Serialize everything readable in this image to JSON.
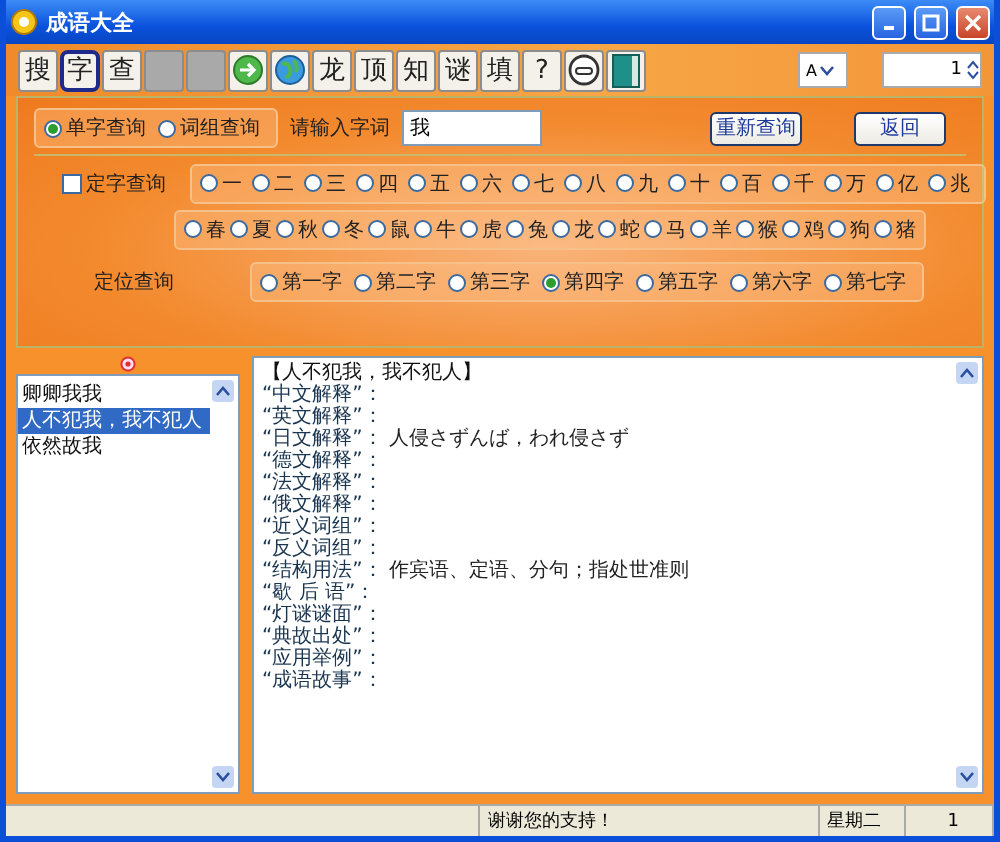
{
  "window": {
    "title": "成语大全"
  },
  "toolbar": {
    "buttons": [
      {
        "kind": "text",
        "label": "搜",
        "selected": false
      },
      {
        "kind": "text",
        "label": "字",
        "selected": true
      },
      {
        "kind": "text",
        "label": "查",
        "selected": false
      },
      {
        "kind": "blank",
        "selected": false
      },
      {
        "kind": "blank",
        "selected": false
      },
      {
        "kind": "arrow",
        "selected": false
      },
      {
        "kind": "globe",
        "selected": false
      },
      {
        "kind": "text",
        "label": "龙",
        "selected": false
      },
      {
        "kind": "text",
        "label": "顶",
        "selected": false
      },
      {
        "kind": "text",
        "label": "知",
        "selected": false
      },
      {
        "kind": "text",
        "label": "谜",
        "selected": false
      },
      {
        "kind": "text",
        "label": "填",
        "selected": false
      },
      {
        "kind": "text",
        "label": "?",
        "selected": false
      },
      {
        "kind": "smiley",
        "selected": false
      },
      {
        "kind": "book",
        "selected": false
      }
    ],
    "font_select": {
      "value": "A"
    },
    "page_spin": {
      "value": "1"
    }
  },
  "search": {
    "modes": [
      {
        "label": "单字查询",
        "selected": true
      },
      {
        "label": "词组查询",
        "selected": false
      }
    ],
    "input_label": "请输入字词",
    "input_value": "我",
    "buttons": [
      "重新查询",
      "返回"
    ]
  },
  "fixed_char": {
    "label": "定字查询",
    "checked": false,
    "numbers": [
      {
        "label": "一",
        "selected": false
      },
      {
        "label": "二",
        "selected": false
      },
      {
        "label": "三",
        "selected": false
      },
      {
        "label": "四",
        "selected": false
      },
      {
        "label": "五",
        "selected": false
      },
      {
        "label": "六",
        "selected": false
      },
      {
        "label": "七",
        "selected": false
      },
      {
        "label": "八",
        "selected": false
      },
      {
        "label": "九",
        "selected": false
      },
      {
        "label": "十",
        "selected": false
      },
      {
        "label": "百",
        "selected": false
      },
      {
        "label": "千",
        "selected": false
      },
      {
        "label": "万",
        "selected": false
      },
      {
        "label": "亿",
        "selected": false
      },
      {
        "label": "兆",
        "selected": false
      }
    ],
    "zodiac": [
      {
        "label": "春",
        "selected": false
      },
      {
        "label": "夏",
        "selected": false
      },
      {
        "label": "秋",
        "selected": false
      },
      {
        "label": "冬",
        "selected": false
      },
      {
        "label": "鼠",
        "selected": false
      },
      {
        "label": "牛",
        "selected": false
      },
      {
        "label": "虎",
        "selected": false
      },
      {
        "label": "兔",
        "selected": false
      },
      {
        "label": "龙",
        "selected": false
      },
      {
        "label": "蛇",
        "selected": false
      },
      {
        "label": "马",
        "selected": false
      },
      {
        "label": "羊",
        "selected": false
      },
      {
        "label": "猴",
        "selected": false
      },
      {
        "label": "鸡",
        "selected": false
      },
      {
        "label": "狗",
        "selected": false
      },
      {
        "label": "猪",
        "selected": false
      }
    ]
  },
  "position": {
    "label": "定位查询",
    "options": [
      {
        "label": "第一字",
        "selected": false
      },
      {
        "label": "第二字",
        "selected": false
      },
      {
        "label": "第三字",
        "selected": false
      },
      {
        "label": "第四字",
        "selected": true
      },
      {
        "label": "第五字",
        "selected": false
      },
      {
        "label": "第六字",
        "selected": false
      },
      {
        "label": "第七字",
        "selected": false
      }
    ]
  },
  "results": {
    "items": [
      {
        "label": "卿卿我我",
        "selected": false
      },
      {
        "label": "人不犯我，我不犯人",
        "selected": true
      },
      {
        "label": "依然故我",
        "selected": false
      }
    ]
  },
  "detail": {
    "title": "【人不犯我，我不犯人】",
    "lines": [
      {
        "label": "“中文解释”："
      },
      {
        "label": "“英文解释”："
      },
      {
        "label": "“日文解释”：",
        "value": "人侵さずんば，われ侵さず"
      },
      {
        "label": "“德文解释”："
      },
      {
        "label": "“法文解释”："
      },
      {
        "label": "“俄文解释”："
      },
      {
        "label": "“近义词组”："
      },
      {
        "label": "“反义词组”："
      },
      {
        "label": "“结构用法”：",
        "value": "作宾语、定语、分句；指处世准则"
      },
      {
        "label": "“歇 后 语”："
      },
      {
        "label": "“灯谜谜面”："
      },
      {
        "label": "“典故出处”："
      },
      {
        "label": "“应用举例”："
      },
      {
        "label": "“成语故事”："
      }
    ]
  },
  "status_bar": {
    "panes": [
      {
        "kind": "empty"
      },
      {
        "kind": "text",
        "text": "谢谢您的支持！"
      },
      {
        "kind": "text",
        "text": "星期二"
      },
      {
        "kind": "text",
        "text": "1"
      }
    ]
  }
}
